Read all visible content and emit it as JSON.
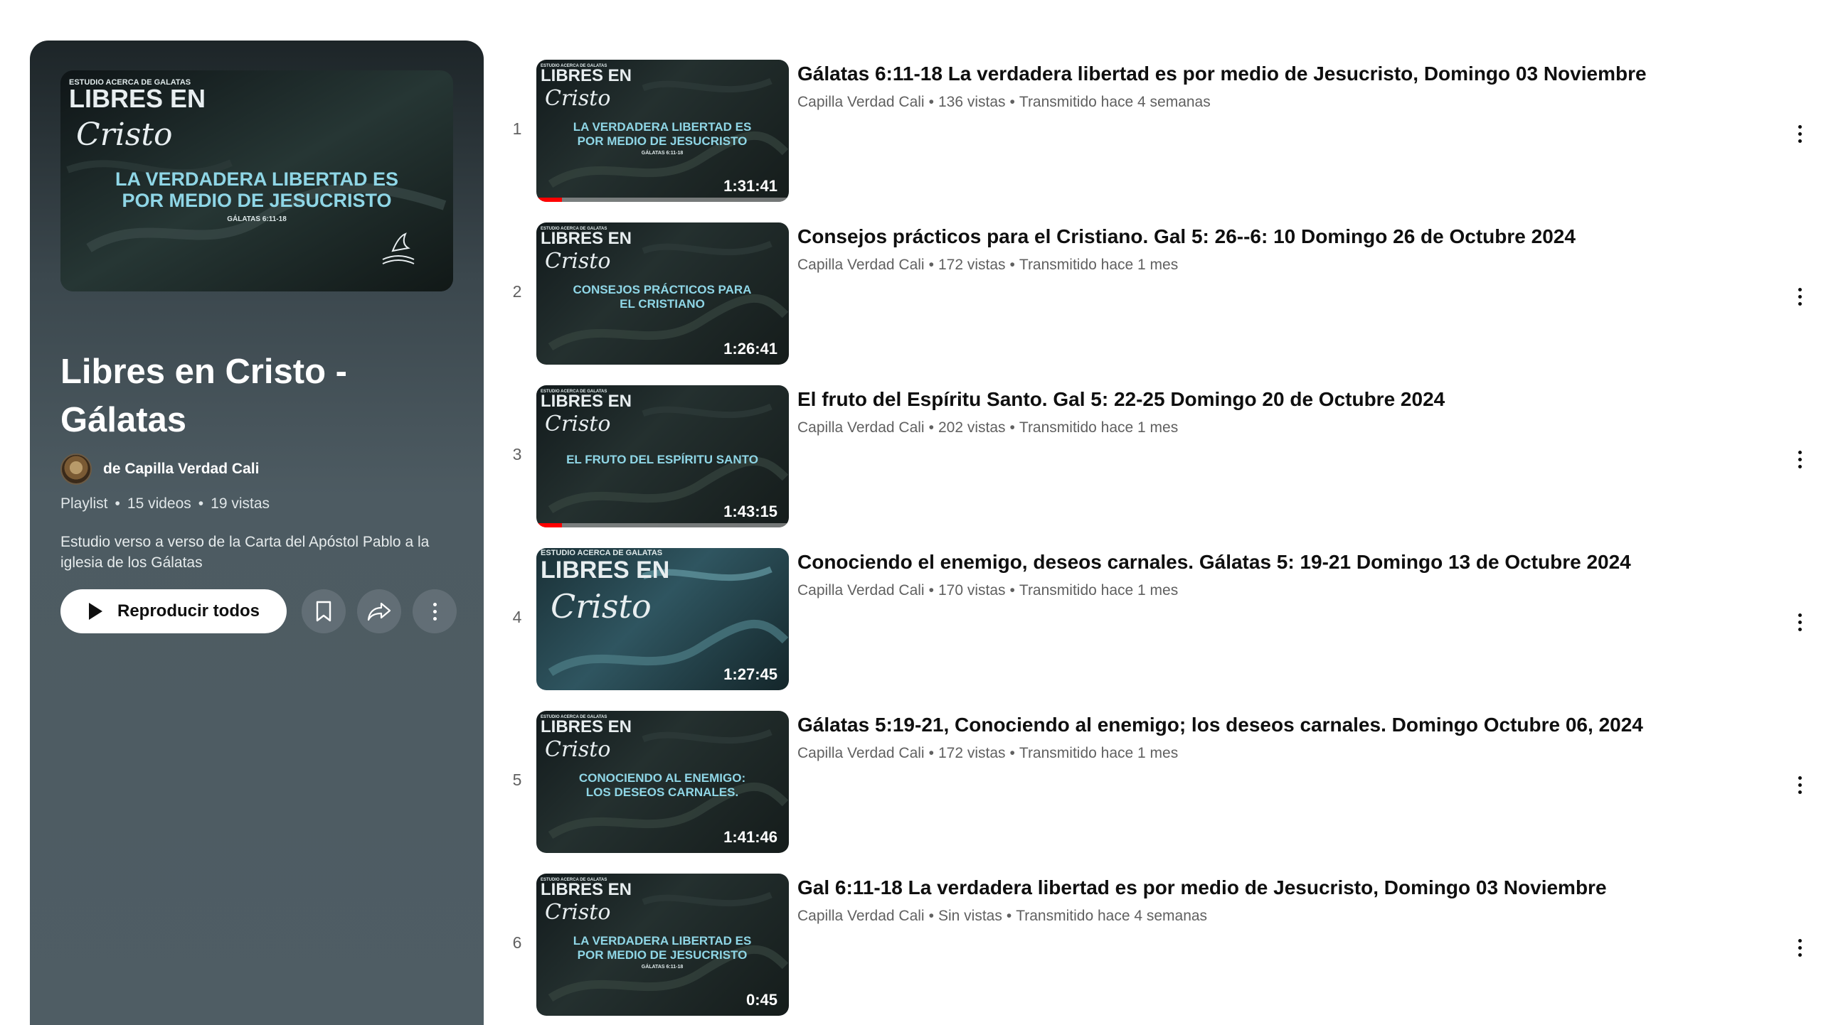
{
  "playlist": {
    "hero_thumbnail": {
      "header_small": "ESTUDIO ACERCA DE GALATAS",
      "brand_line1": "LIBRES EN",
      "brand_line2": "Cristo",
      "main_text_line1": "LA VERDADERA LIBERTAD ES",
      "main_text_line2": "POR MEDIO DE JESUCRISTO",
      "reference": "GÁLATAS 6:11-18"
    },
    "title": "Libres en Cristo - Gálatas",
    "owner": "de Capilla Verdad Cali",
    "type": "Playlist",
    "video_count": "15 videos",
    "views": "19 vistas",
    "description": "Estudio verso a verso de la Carta del Apóstol Pablo a la iglesia de los Gálatas",
    "play_all_label": "Reproducir todos",
    "colors": {
      "panel_top": "#1d2528",
      "panel_bottom": "#4f5d64",
      "accent_text": "#7fd0e0"
    }
  },
  "videos": [
    {
      "index": "1",
      "title": "Gálatas 6:11-18 La verdadera libertad es por medio de Jesucristo, Domingo 03 Noviembre",
      "channel": "Capilla Verdad Cali",
      "views": "136 vistas",
      "published": "Transmitido hace 4 semanas",
      "duration": "1:31:41",
      "thumb_text_line1": "LA VERDADERA LIBERTAD ES",
      "thumb_text_line2": "POR MEDIO DE JESUCRISTO",
      "thumb_ref": "GÁLATAS 6:11-18",
      "watched_progress": 0.1
    },
    {
      "index": "2",
      "title": "Consejos prácticos para el Cristiano. Gal 5: 26--6: 10 Domingo 26 de Octubre 2024",
      "channel": "Capilla Verdad Cali",
      "views": "172 vistas",
      "published": "Transmitido hace 1 mes",
      "duration": "1:26:41",
      "thumb_text_line1": "CONSEJOS PRÁCTICOS PARA",
      "thumb_text_line2": "EL CRISTIANO",
      "thumb_ref": "",
      "watched_progress": 0
    },
    {
      "index": "3",
      "title": "El fruto del Espíritu Santo. Gal 5: 22-25 Domingo 20 de Octubre 2024",
      "channel": "Capilla Verdad Cali",
      "views": "202 vistas",
      "published": "Transmitido hace 1 mes",
      "duration": "1:43:15",
      "thumb_text_line1": "EL FRUTO DEL ESPÍRITU SANTO",
      "thumb_text_line2": "",
      "thumb_ref": "",
      "watched_progress": 0.1
    },
    {
      "index": "4",
      "title": "Conociendo el enemigo, deseos carnales. Gálatas 5: 19-21 Domingo 13 de Octubre 2024",
      "channel": "Capilla Verdad Cali",
      "views": "170 vistas",
      "published": "Transmitido hace 1 mes",
      "duration": "1:27:45",
      "thumb_text_line1": "",
      "thumb_text_line2": "",
      "thumb_ref": "",
      "watched_progress": 0
    },
    {
      "index": "5",
      "title": "Gálatas 5:19-21, Conociendo al enemigo; los deseos carnales. Domingo Octubre 06, 2024",
      "channel": "Capilla Verdad Cali",
      "views": "172 vistas",
      "published": "Transmitido hace 1 mes",
      "duration": "1:41:46",
      "thumb_text_line1": "CONOCIENDO AL ENEMIGO:",
      "thumb_text_line2": "LOS DESEOS CARNALES.",
      "thumb_ref": "",
      "watched_progress": 0
    },
    {
      "index": "6",
      "title": "Gal 6:11-18 La verdadera libertad es por medio de Jesucristo, Domingo 03 Noviembre",
      "channel": "Capilla Verdad Cali",
      "views": "Sin vistas",
      "published": "Transmitido hace 4 semanas",
      "duration": "0:45",
      "thumb_text_line1": "LA VERDADERA LIBERTAD ES",
      "thumb_text_line2": "POR MEDIO DE JESUCRISTO",
      "thumb_ref": "GÁLATAS 6:11-18",
      "watched_progress": 0
    }
  ],
  "thumb_brand": {
    "line1": "LIBRES EN",
    "line2": "Cristo",
    "small_header": "ESTUDIO ACERCA DE GALATAS"
  },
  "icons": {
    "play": "play-icon",
    "save": "bookmark-icon",
    "share": "share-icon",
    "more": "more-vert-icon"
  }
}
